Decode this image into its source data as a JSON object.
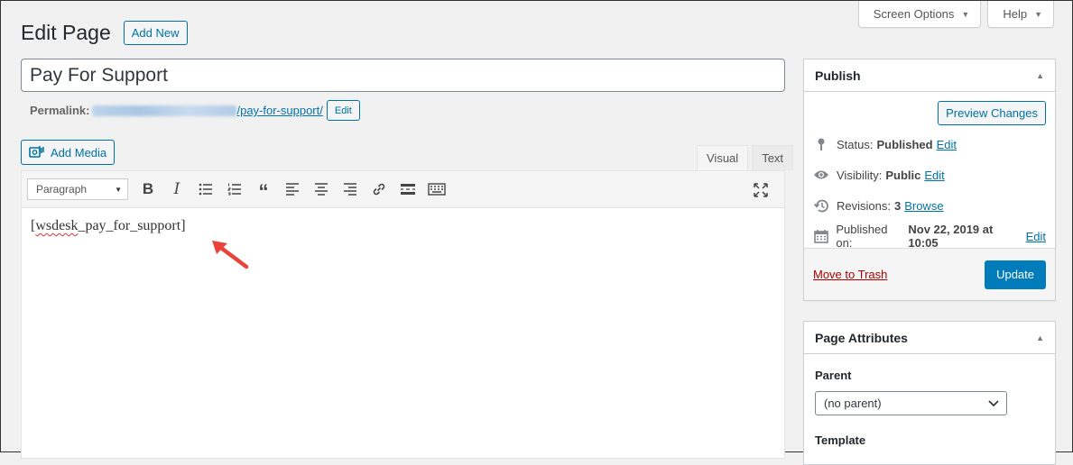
{
  "screen_meta": {
    "screen_options_label": "Screen Options",
    "help_label": "Help"
  },
  "header": {
    "title": "Edit Page",
    "add_new_label": "Add New"
  },
  "post": {
    "title_value": "Pay For Support",
    "permalink_label": "Permalink:",
    "permalink_slug": "/pay-for-support/",
    "permalink_edit_label": "Edit"
  },
  "editor": {
    "add_media_label": "Add Media",
    "tabs": [
      {
        "label": "Visual",
        "active": true
      },
      {
        "label": "Text",
        "active": false
      }
    ],
    "format_select_value": "Paragraph",
    "toolbar_icons": [
      "bold-icon",
      "italic-icon",
      "bulleted-list-icon",
      "numbered-list-icon",
      "blockquote-icon",
      "align-left-icon",
      "align-center-icon",
      "align-right-icon",
      "link-icon",
      "read-more-icon",
      "toolbar-toggle-icon",
      "fullscreen-icon"
    ],
    "content": {
      "open_bracket": "[",
      "misspelled_word": "wsdesk",
      "rest": "_pay_for_support]"
    },
    "annotation_color": "#e8443a"
  },
  "publish": {
    "title": "Publish",
    "preview_label": "Preview Changes",
    "status_label": "Status:",
    "status_value": "Published",
    "status_edit": "Edit",
    "visibility_label": "Visibility:",
    "visibility_value": "Public",
    "visibility_edit": "Edit",
    "revisions_label": "Revisions:",
    "revisions_value": "3",
    "revisions_browse": "Browse",
    "published_on_label": "Published on:",
    "published_on_value": "Nov 22, 2019 at 10:05",
    "published_on_edit": "Edit",
    "trash_label": "Move to Trash",
    "update_label": "Update",
    "primary_color": "#007cba"
  },
  "page_attributes": {
    "title": "Page Attributes",
    "parent_label": "Parent",
    "parent_value": "(no parent)",
    "template_label": "Template"
  }
}
